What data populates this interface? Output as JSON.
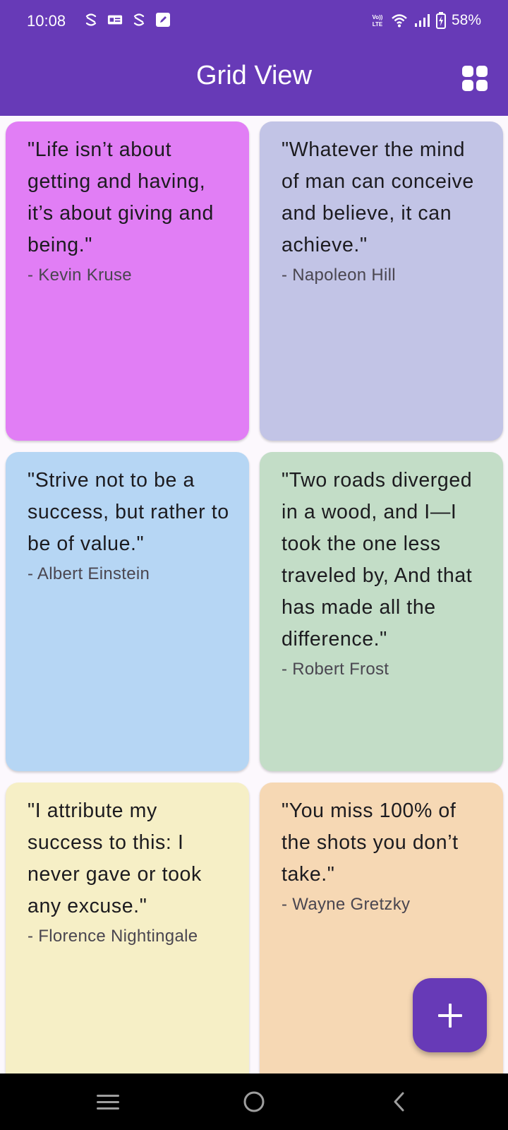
{
  "status_bar": {
    "time": "10:08",
    "left_icons": [
      "s-notification-icon",
      "id-card-icon",
      "s-notification-icon",
      "edit-note-icon"
    ],
    "right_icons": [
      "volte-icon",
      "wifi-icon",
      "cell-signal-icon",
      "battery-charging-icon"
    ],
    "volte_text": "Vo)) LTE",
    "battery": "58%"
  },
  "app_bar": {
    "title": "Grid View",
    "toggle_icon": "grid-view-icon"
  },
  "colors": {
    "primary": "#673ab7",
    "card_backgrounds": [
      "#e17ef5",
      "#c2c4e6",
      "#b6d6f4",
      "#c3ddc7",
      "#f6efc6",
      "#f6d8b4"
    ]
  },
  "quotes": [
    {
      "text": "\"Life isn’t about getting and having, it’s about giving and being.\"",
      "author": "- Kevin Kruse"
    },
    {
      "text": "\"Whatever the mind of man can conceive and believe, it can achieve.\"",
      "author": "- Napoleon Hill"
    },
    {
      "text": "\"Strive not to be a success, but rather to be of value.\"",
      "author": "- Albert Einstein"
    },
    {
      "text": "\"Two roads diverged in a wood, and I—I took the one less traveled by, And that has made all the difference.\"",
      "author": "- Robert Frost"
    },
    {
      "text": "\"I attribute my success to this: I never gave or took any excuse.\"",
      "author": "- Florence Nightingale"
    },
    {
      "text": "\"You miss 100% of the shots you don’t take.\"",
      "author": "- Wayne Gretzky"
    }
  ],
  "fab": {
    "icon": "add-icon"
  },
  "nav_bar": {
    "icons": [
      "recents-icon",
      "home-icon",
      "back-icon"
    ]
  }
}
